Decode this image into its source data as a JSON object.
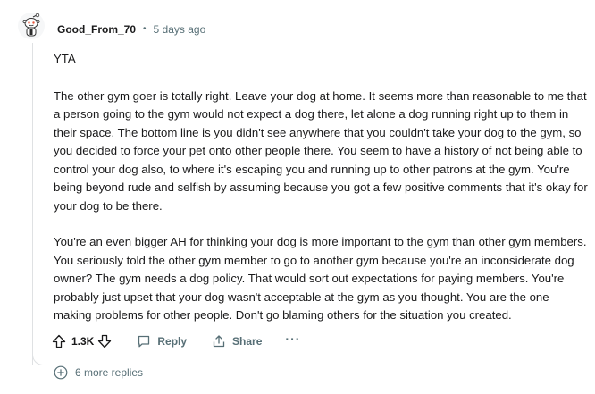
{
  "comment": {
    "author": "Good_From_70",
    "separator": "•",
    "timestamp": "5 days ago",
    "paragraphs": [
      "YTA",
      "The other gym goer is totally right. Leave your dog at home. It seems more than reasonable to me that a person going to the gym would not expect a dog there, let alone a dog running right up to them in their space. The bottom line is you didn't see anywhere that you couldn't take your dog to the gym, so you decided to force your pet onto other people there. You seem to have a history of not being able to control your dog also, to where it's escaping you and running up to other patrons at the gym. You're being beyond rude and selfish by assuming because you got a few positive comments that it's okay for your dog to be there.",
      "You're an even bigger AH for thinking your dog is more important to the gym than other gym members. You seriously told the other gym member to go to another gym because you're an inconsiderate dog owner? The gym needs a dog policy. That would sort out expectations for paying members. You're probably just upset that your dog wasn't acceptable at the gym as you thought. You are the one making problems for other people. Don't go blaming others for the situation you created."
    ]
  },
  "actions": {
    "score": "1.3K",
    "reply_label": "Reply",
    "share_label": "Share",
    "more_label": "···"
  },
  "more_replies": {
    "label": "6 more replies"
  },
  "icons": {
    "upvote": "upvote-arrow-icon",
    "downvote": "downvote-arrow-icon",
    "reply": "comment-bubble-icon",
    "share": "share-icon",
    "expand": "plus-circle-icon",
    "avatar": "snoo-avatar-icon"
  },
  "colors": {
    "text": "#1a1a1b",
    "muted": "#576f76",
    "thread_line": "#dfe1e3"
  }
}
